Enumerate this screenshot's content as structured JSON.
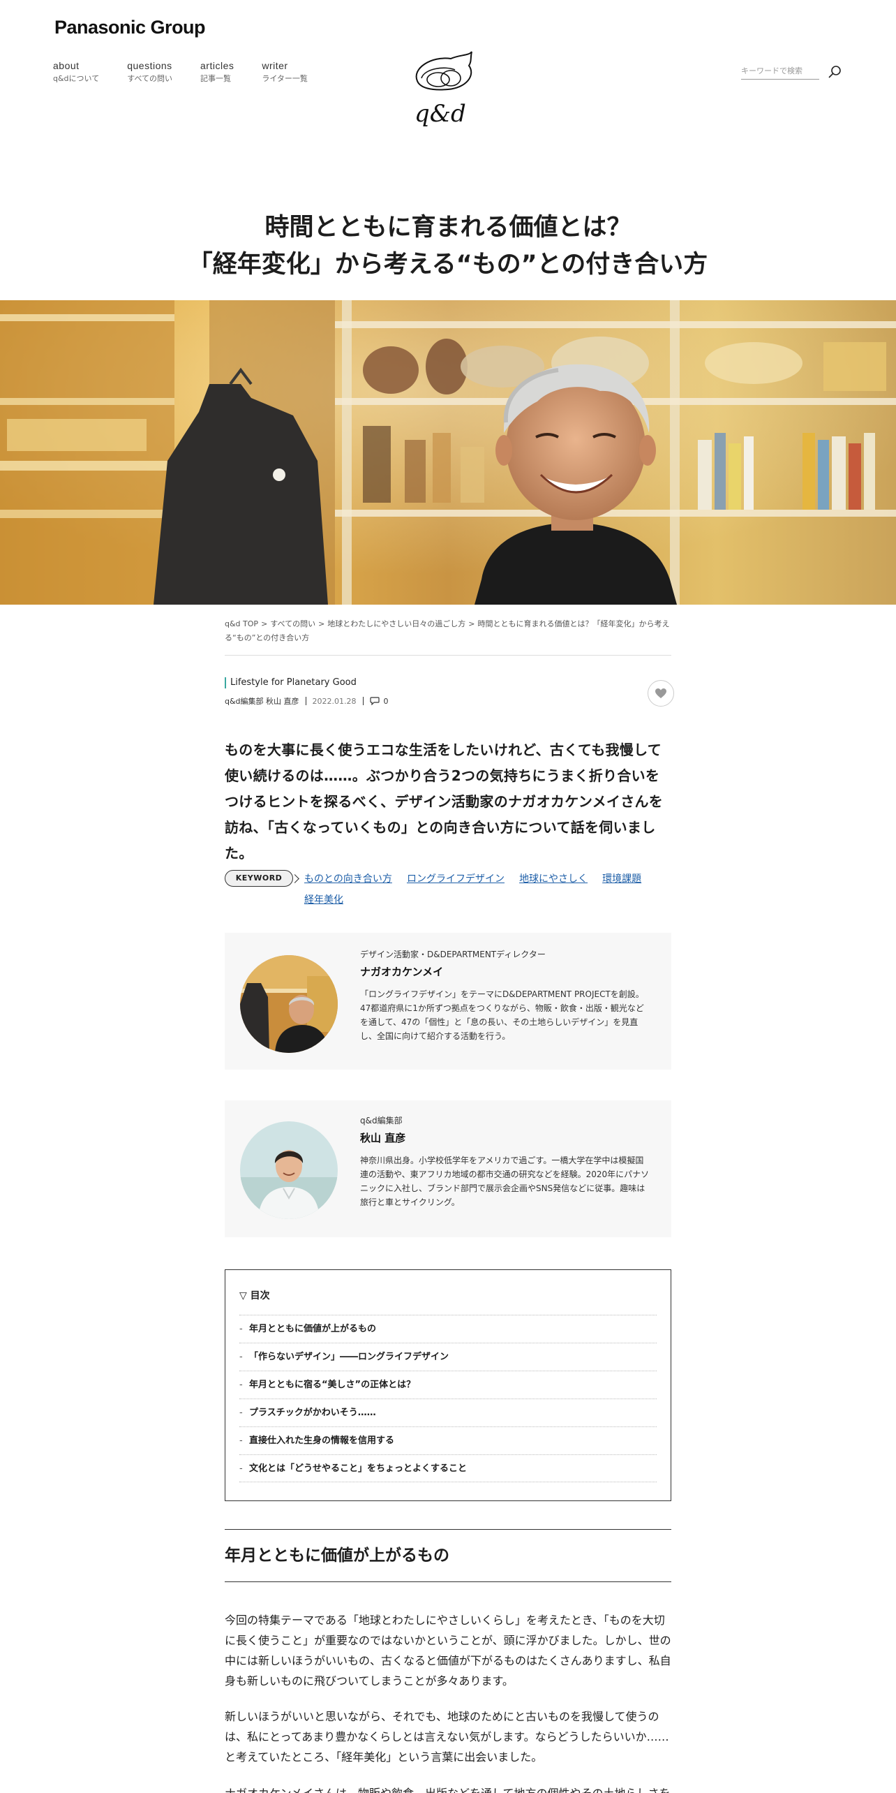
{
  "header": {
    "brand": "Panasonic Group",
    "nav": [
      {
        "en": "about",
        "ja": "q&dについて"
      },
      {
        "en": "questions",
        "ja": "すべての問い"
      },
      {
        "en": "articles",
        "ja": "記事一覧"
      },
      {
        "en": "writer",
        "ja": "ライター一覧"
      }
    ],
    "logo_text": "q&d",
    "search_placeholder": "キーワードで検索"
  },
  "article": {
    "title_line1": "時間とともに育まれる価値とは？",
    "title_line2": "「経年変化」から考える“もの”との付き合い方",
    "breadcrumbs": [
      "q&d TOP",
      "すべての問い",
      "地球とわたしにやさしい日々の過ごし方",
      "時間とともに育まれる価値とは？「経年変化」から考える“もの”との付き合い方"
    ],
    "breadcrumb_sep": ">",
    "category": "Lifestyle for Planetary Good",
    "author": "q&d編集部 秋山 直彦",
    "date": "2022.01.28",
    "comment_count": "0",
    "lead": "ものを大事に長く使うエコな生活をしたいけれど、古くても我慢して使い続けるのは……。ぶつかり合う2つの気持ちにうまく折り合いをつけるヒントを探るべく、デザイン活動家のナガオカケンメイさんを訪ね、「古くなっていくもの」との向き合い方について話を伺いました。",
    "keyword_label": "KEYWORD",
    "keywords": [
      "ものとの向き合い方",
      "ロングライフデザイン",
      "地球にやさしく",
      "環境課題",
      "経年美化"
    ]
  },
  "profiles": [
    {
      "role": "デザイン活動家・D&DEPARTMENTディレクター",
      "name": "ナガオカケンメイ",
      "bio": "「ロングライフデザイン」をテーマにD&DEPARTMENT PROJECTを創設。47都道府県に1か所ずつ拠点をつくりながら、物販・飲食・出版・観光などを通して、47の「個性」と「息の長い、その土地らしいデザイン」を見直し、全国に向けて紹介する活動を行う。"
    },
    {
      "role": "q&d編集部",
      "name": "秋山 直彦",
      "bio": "神奈川県出身。小学校低学年をアメリカで過ごす。一橋大学在学中は模擬国連の活動や、東アフリカ地域の都市交通の研究などを経験。2020年にパナソニックに入社し、ブランド部門で展示会企画やSNS発信などに従事。趣味は旅行と車とサイクリング。"
    }
  ],
  "toc": {
    "heading": "▽ 目次",
    "items": [
      "年月とともに価値が上がるもの",
      "「作らないデザイン」――ロングライフデザイン",
      "年月とともに宿る“美しさ”の正体とは？",
      "プラスチックがかわいそう……",
      "直接仕入れた生身の情報を信用する",
      "文化とは「どうせやること」をちょっとよくすること"
    ]
  },
  "section1": {
    "heading": "年月とともに価値が上がるもの",
    "p1": "今回の特集テーマである「地球とわたしにやさしいくらし」を考えたとき、「ものを大切に長く使うこと」が重要なのではないかということが、頭に浮かびました。しかし、世の中には新しいほうがいいもの、古くなると価値が下がるものはたくさんありますし、私自身も新しいものに飛びついてしまうことが多々あります。",
    "p2": "新しいほうがいいと思いながら、それでも、地球のためにと古いものを我慢して使うのは、私にとってあまり豊かなくらしとは言えない気がします。ならどうしたらいいか……と考えていたところ、「経年美化」という言葉に出会いました。",
    "p3": "ナガオカケンメイさんは、物販や飲食、出版などを通して地方の個性やその土地らしさを見つめ直す活動をしています。"
  },
  "colors": {
    "accent_link": "#1e5fa8",
    "category_bar": "#3aa7a0",
    "profile_bg": "#f7f7f7"
  }
}
